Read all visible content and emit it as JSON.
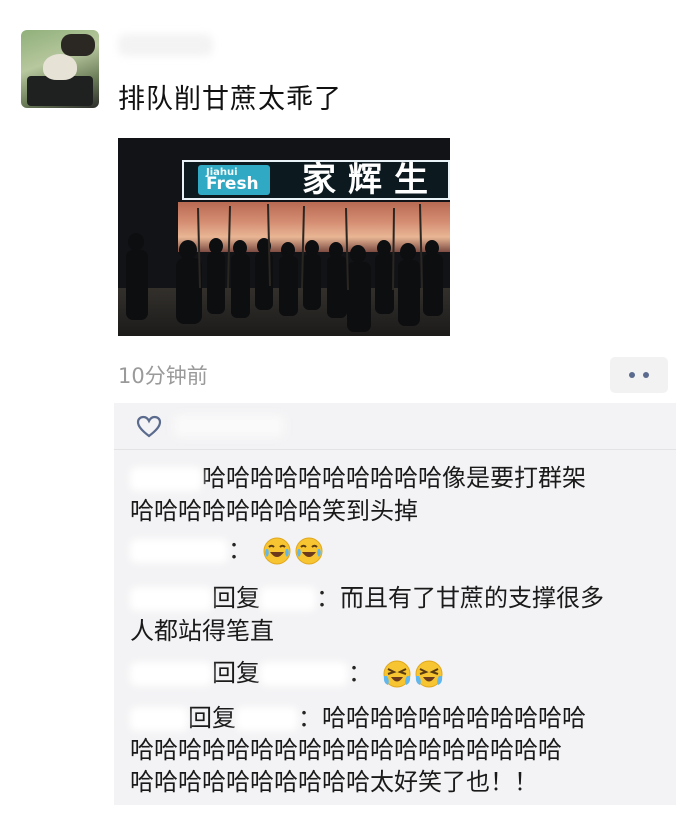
{
  "post": {
    "text": "排队削甘蔗太乖了",
    "timestamp": "10分钟前"
  },
  "photo": {
    "sign_logo_top": "Jiahui",
    "sign_logo_main": "Fresh",
    "sign_store_name": "家辉生"
  },
  "icons": {
    "like": "heart-icon",
    "more": "more-dots-icon",
    "emoji": "face-with-tears-of-joy-icon",
    "emoji_alt": "loudly-laughing-face-icon"
  },
  "colors": {
    "link_blue": "#5b6b8e",
    "comment_bg": "#f3f3f5",
    "timestamp_gray": "#9a9a9a"
  },
  "comments": [
    {
      "line1": "哈哈哈哈哈哈哈哈哈哈像是要打群架",
      "line2": "哈哈哈哈哈哈哈哈笑到头掉"
    },
    {
      "separator": "："
    },
    {
      "reply_word": "回复",
      "separator": "：",
      "line1": "而且有了甘蔗的支撑很多",
      "line2": "人都站得笔直"
    },
    {
      "reply_word": "回复",
      "separator": "："
    },
    {
      "reply_word": "回复",
      "separator": "：",
      "line1": "哈哈哈哈哈哈哈哈哈哈哈",
      "line2": "哈哈哈哈哈哈哈哈哈哈哈哈哈哈哈哈哈哈",
      "line3": "哈哈哈哈哈哈哈哈哈哈太好笑了也！！"
    }
  ]
}
